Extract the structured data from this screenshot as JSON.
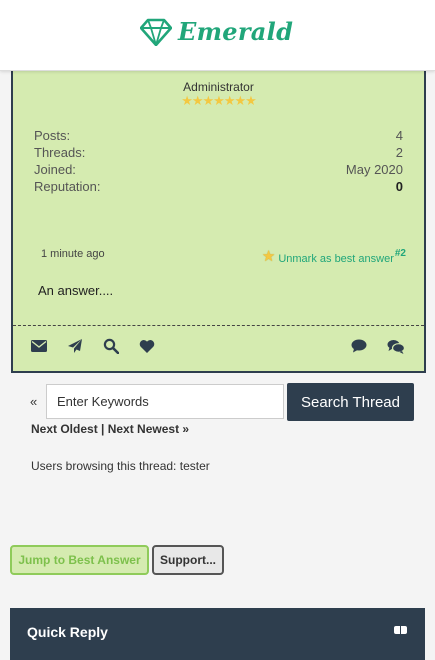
{
  "app": {
    "brand": "Emerald",
    "brand_color": "#21a67a"
  },
  "post": {
    "role": "Administrator",
    "stars": "★★★★★★★",
    "stats": [
      {
        "label": "Posts:",
        "value": "4"
      },
      {
        "label": "Threads:",
        "value": "2"
      },
      {
        "label": "Joined:",
        "value": "May 2020"
      },
      {
        "label": "Reputation:",
        "value": "0"
      }
    ],
    "time": "1 minute ago",
    "unmark_label": "Unmark as best answer",
    "post_number": "#2",
    "body": "An answer....",
    "icons": [
      "envelope-icon",
      "paper-plane-icon",
      "search-icon",
      "heart-icon",
      "comment-icon",
      "comments-icon"
    ]
  },
  "search": {
    "prev_arrow": "«",
    "placeholder": "Enter Keywords",
    "button": "Search Thread"
  },
  "nav": {
    "text": "Next Oldest | Next Newest »"
  },
  "browsing": {
    "text": "Users browsing this thread: tester"
  },
  "buttons": {
    "jump": "Jump to Best Answer",
    "support": "Support..."
  },
  "quick_reply": {
    "title": "Quick Reply"
  },
  "colors": {
    "post_bg": "#d5ebb0",
    "dark": "#2e3e4e",
    "star": "#f3c842",
    "page_bg": "#f4f4f4"
  }
}
